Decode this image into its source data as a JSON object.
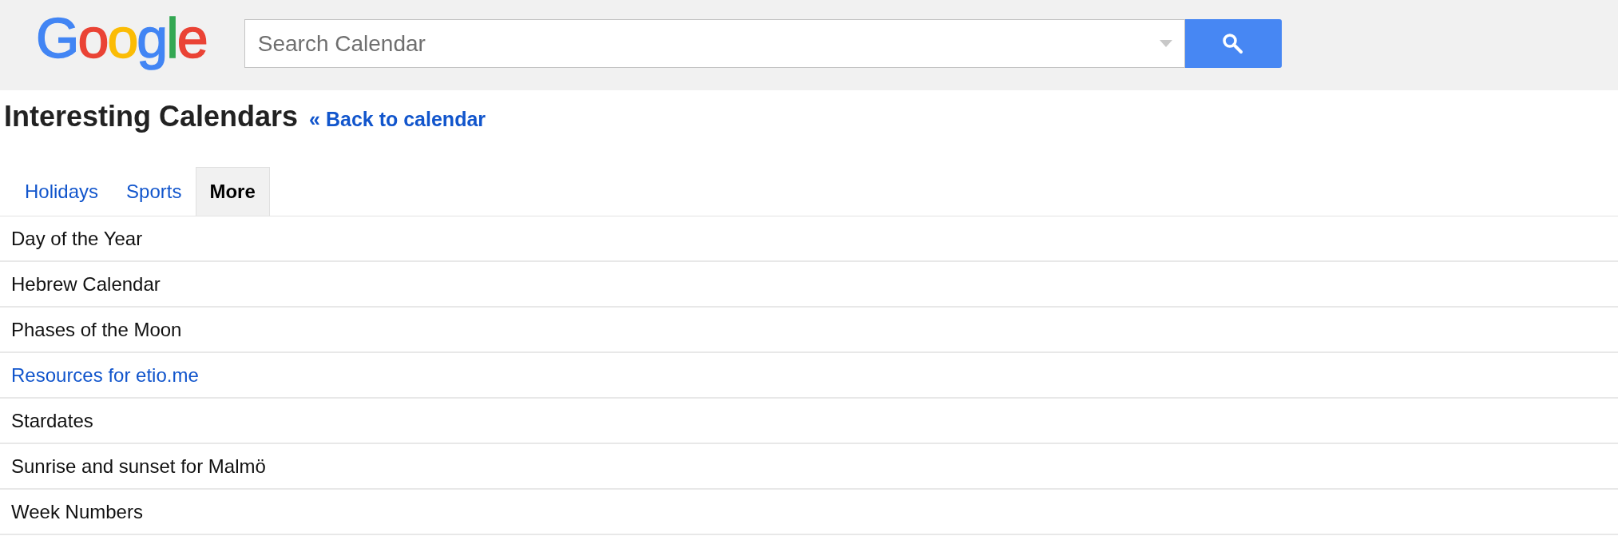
{
  "header": {
    "logo": [
      {
        "letter": "G",
        "color": "#4285f4"
      },
      {
        "letter": "o",
        "color": "#ea4335"
      },
      {
        "letter": "o",
        "color": "#fbbc05"
      },
      {
        "letter": "g",
        "color": "#4285f4"
      },
      {
        "letter": "l",
        "color": "#34a853"
      },
      {
        "letter": "e",
        "color": "#ea4335"
      }
    ],
    "search": {
      "placeholder": "Search Calendar"
    }
  },
  "page": {
    "title": "Interesting Calendars",
    "back_link": "« Back to calendar"
  },
  "tabs": [
    {
      "label": "Holidays",
      "selected": false
    },
    {
      "label": "Sports",
      "selected": false
    },
    {
      "label": "More",
      "selected": true
    }
  ],
  "calendars": [
    {
      "name": "Day of the Year",
      "kind": "text"
    },
    {
      "name": "Hebrew Calendar",
      "kind": "text"
    },
    {
      "name": "Phases of the Moon",
      "kind": "text"
    },
    {
      "name": "Resources for etio.me",
      "kind": "link"
    },
    {
      "name": "Stardates",
      "kind": "text"
    },
    {
      "name": "Sunrise and sunset for Malmö",
      "kind": "text"
    },
    {
      "name": "Week Numbers",
      "kind": "text"
    }
  ]
}
